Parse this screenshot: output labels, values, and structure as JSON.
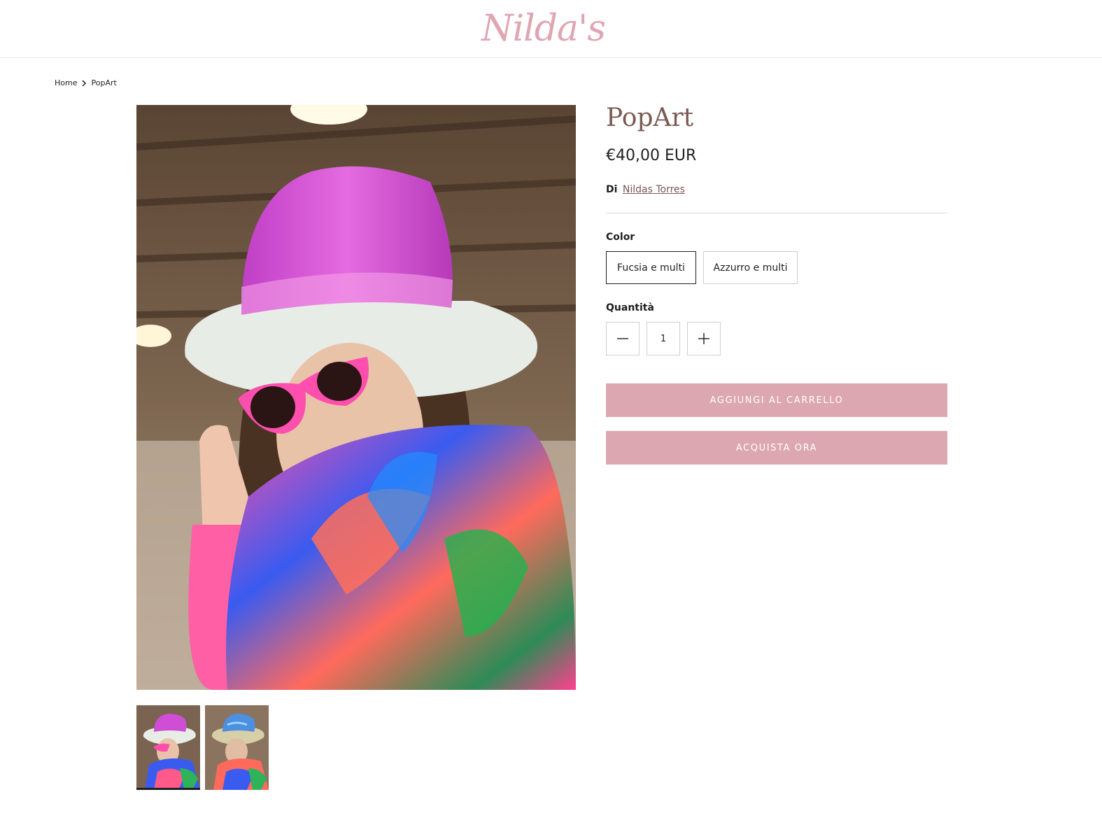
{
  "header": {
    "logo_text": "Nilda's"
  },
  "breadcrumb": {
    "home": "Home",
    "current": "PopArt"
  },
  "product": {
    "title": "PopArt",
    "price": "€40,00 EUR",
    "vendor_prefix": "Di",
    "vendor_name": "Nildas Torres"
  },
  "options": {
    "color_label": "Color",
    "colors": [
      "Fucsia e multi",
      "Azzurro e multi"
    ],
    "selected_color": "Fucsia e multi"
  },
  "quantity": {
    "label": "Quantità",
    "value": "1"
  },
  "buttons": {
    "add_to_cart": "AGGIUNGI AL CARRELLO",
    "buy_now": "ACQUISTA ORA"
  },
  "gallery": {
    "active_index": 1,
    "image_count": 2
  },
  "colors": {
    "brand_pink": "#dca7b0",
    "title_brown": "#7a5a52",
    "logo_pink": "#dfa6b2"
  },
  "icons": {
    "breadcrumb_separator": "chevron-right-icon",
    "gallery_next": "chevron-right-icon",
    "qty_minus": "minus-icon",
    "qty_plus": "plus-icon"
  }
}
